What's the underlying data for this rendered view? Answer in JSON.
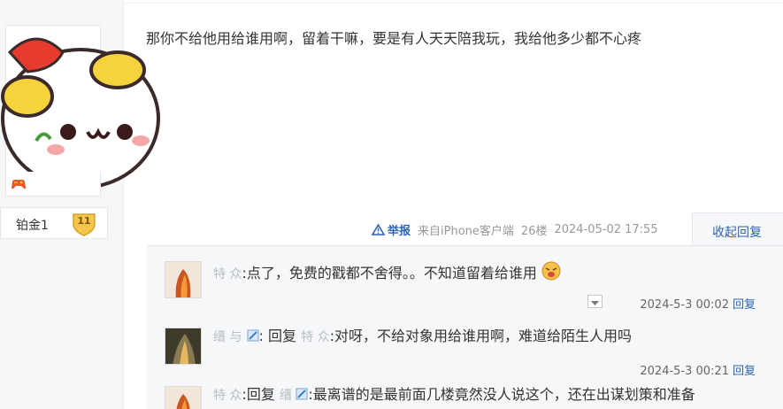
{
  "user": {
    "level_name": "铂金1",
    "level_number": "11",
    "badge_icon": "game-controller-icon",
    "avatar_icon": "cartoon-face-avatar"
  },
  "post": {
    "content": "那你不给他用给谁用啊，留着干嘛，要是有人天天陪我玩，我给他多少都不心疼",
    "report_label": "举报",
    "source": "来自iPhone客户端",
    "floor": "26楼",
    "time": "2024-05-02 17:55",
    "collapse_label": "收起回复"
  },
  "replies": [
    {
      "username": "特 众",
      "prefix": ":",
      "text": "点了，免费的戳都不舍得。。不知道留着给谁用",
      "time": "2024-5-3 00:02",
      "reply_label": "回复"
    },
    {
      "username": "缙 与",
      "reply_word": "回复",
      "target": "特 众",
      "text": ":对呀，不给对象用给谁用啊，难道给陌生人用吗",
      "time": "2024-5-3 00:21",
      "reply_label": "回复"
    },
    {
      "username": "特 众",
      "reply_word": "回复",
      "target": "缙 ",
      "text": ":最离谱的是最前面几楼竟然没人说这个，还在出谋划策和准备"
    }
  ],
  "colors": {
    "link": "#2d64b3",
    "muted": "#999999",
    "panel": "#f6f7f9"
  }
}
